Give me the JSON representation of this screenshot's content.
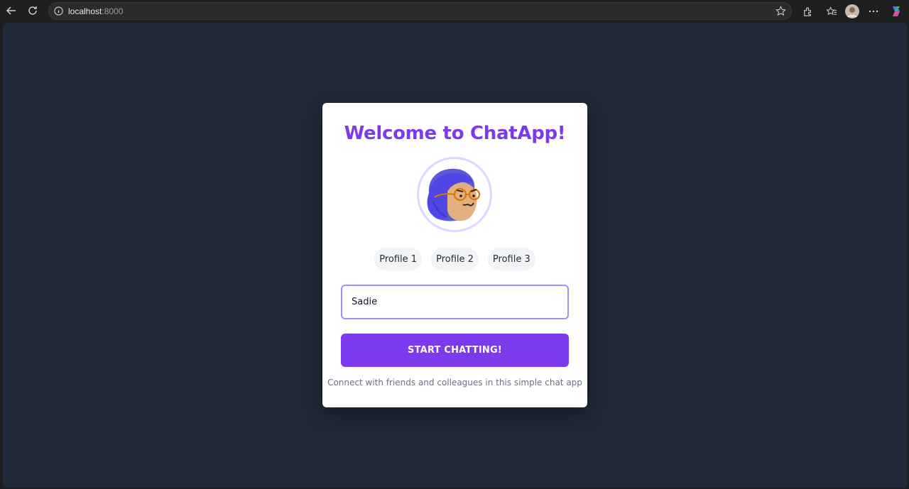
{
  "browser": {
    "url_host": "localhost",
    "url_port": ":8000"
  },
  "card": {
    "title": "Welcome to ChatApp!",
    "avatar_icon": "avatar-illustration-purple-hair-glasses",
    "profiles": [
      "Profile 1",
      "Profile 2",
      "Profile 3"
    ],
    "name_input": {
      "value": "Sadie",
      "placeholder": ""
    },
    "start_button_label": "START CHATTING!",
    "tagline": "Connect with friends and colleagues in this simple chat app"
  },
  "colors": {
    "accent": "#7c3aed",
    "background": "#1f2937",
    "input_border": "#a78bfa"
  }
}
